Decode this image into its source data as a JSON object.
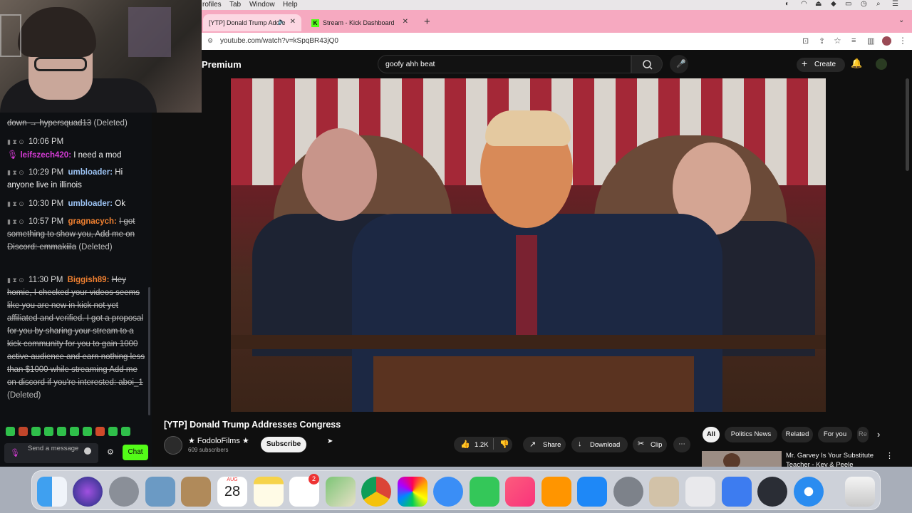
{
  "menubar": {
    "items": [
      "rofiles",
      "Tab",
      "Window",
      "Help"
    ],
    "status_icons": [
      "siri-icon",
      "wifi-icon",
      "eject-icon",
      "volume-icon",
      "battery-icon",
      "clock-icon",
      "search-icon",
      "control-center-icon"
    ]
  },
  "tabs": [
    {
      "title": "[YTP] Donald Trump Addre",
      "active": true
    },
    {
      "title": "Stream - Kick Dashboard",
      "active": false
    }
  ],
  "address": {
    "url": "youtube.com/watch?v=kSpqBR43jQ0"
  },
  "chat": {
    "messages": [
      {
        "prefix": "down → hypersquad13",
        "suffix": "(Deleted)",
        "deleted": true
      },
      {
        "time": "10:06 PM",
        "user": "",
        "text": ""
      },
      {
        "user": "leifszech420:",
        "text": "I need a mod",
        "user_color": "#d63bd6"
      },
      {
        "time": "10:29 PM",
        "user": "umbloader:",
        "text": "Hi anyone live in illinois",
        "user_color": "#9dc4f5"
      },
      {
        "time": "10:30 PM",
        "user": "umbloader:",
        "text": "Ok",
        "user_color": "#9dc4f5"
      },
      {
        "time": "10:57 PM",
        "user": "gragnacych:",
        "text": "I got something to show you, Add me on Discord: emmakiila",
        "suffix": "(Deleted)",
        "user_color": "#f08030",
        "deleted": true
      },
      {
        "time": "11:30 PM",
        "user": "Biggish89:",
        "text": "Hey homie, I checked your videos seems like you are new in kick not yet affiliated and verified. I got a proposal for you by sharing your stream to a kick community for you to gain 1000 active audience and earn nothing less than $1000 while streaming Add me on discord if you're interested: aboi_1",
        "suffix": "(Deleted)",
        "user_color": "#f08030",
        "deleted": true
      }
    ],
    "input_placeholder": "Send a message",
    "chat_button": "Chat",
    "accent": "#53fc18"
  },
  "youtube": {
    "brand": "Premium",
    "search_value": "goofy ahh beat",
    "create_label": "Create",
    "video_title": "[YTP] Donald Trump Addresses Congress",
    "channel_name": "★ FodoloFilms ★",
    "subscribers": "609 subscribers",
    "subscribe_label": "Subscribe",
    "likes": "1.2K",
    "share_label": "Share",
    "download_label": "Download",
    "clip_label": "Clip",
    "chips": [
      "All",
      "Politics News",
      "Related",
      "For you",
      "Re"
    ],
    "rec_title_1": "Mr. Garvey Is Your Substitute",
    "rec_title_2": "Teacher - Key & Peele"
  },
  "dock": {
    "calendar_month": "AUG",
    "calendar_day": "28",
    "reminders_badge": "2",
    "apps": [
      "finder-icon",
      "siri-icon",
      "launchpad-icon",
      "preview-icon",
      "notes-folder-icon",
      "calendar-icon",
      "notes-icon",
      "reminders-icon",
      "maps-icon",
      "chrome-icon",
      "photos-icon",
      "messages-icon",
      "facetime-icon",
      "music-icon",
      "books-icon",
      "app-store-icon",
      "system-settings-icon",
      "photo-booth-icon",
      "printer-icon",
      "roblox-icon",
      "obs-icon",
      "safari-icon",
      "trash-icon"
    ]
  }
}
